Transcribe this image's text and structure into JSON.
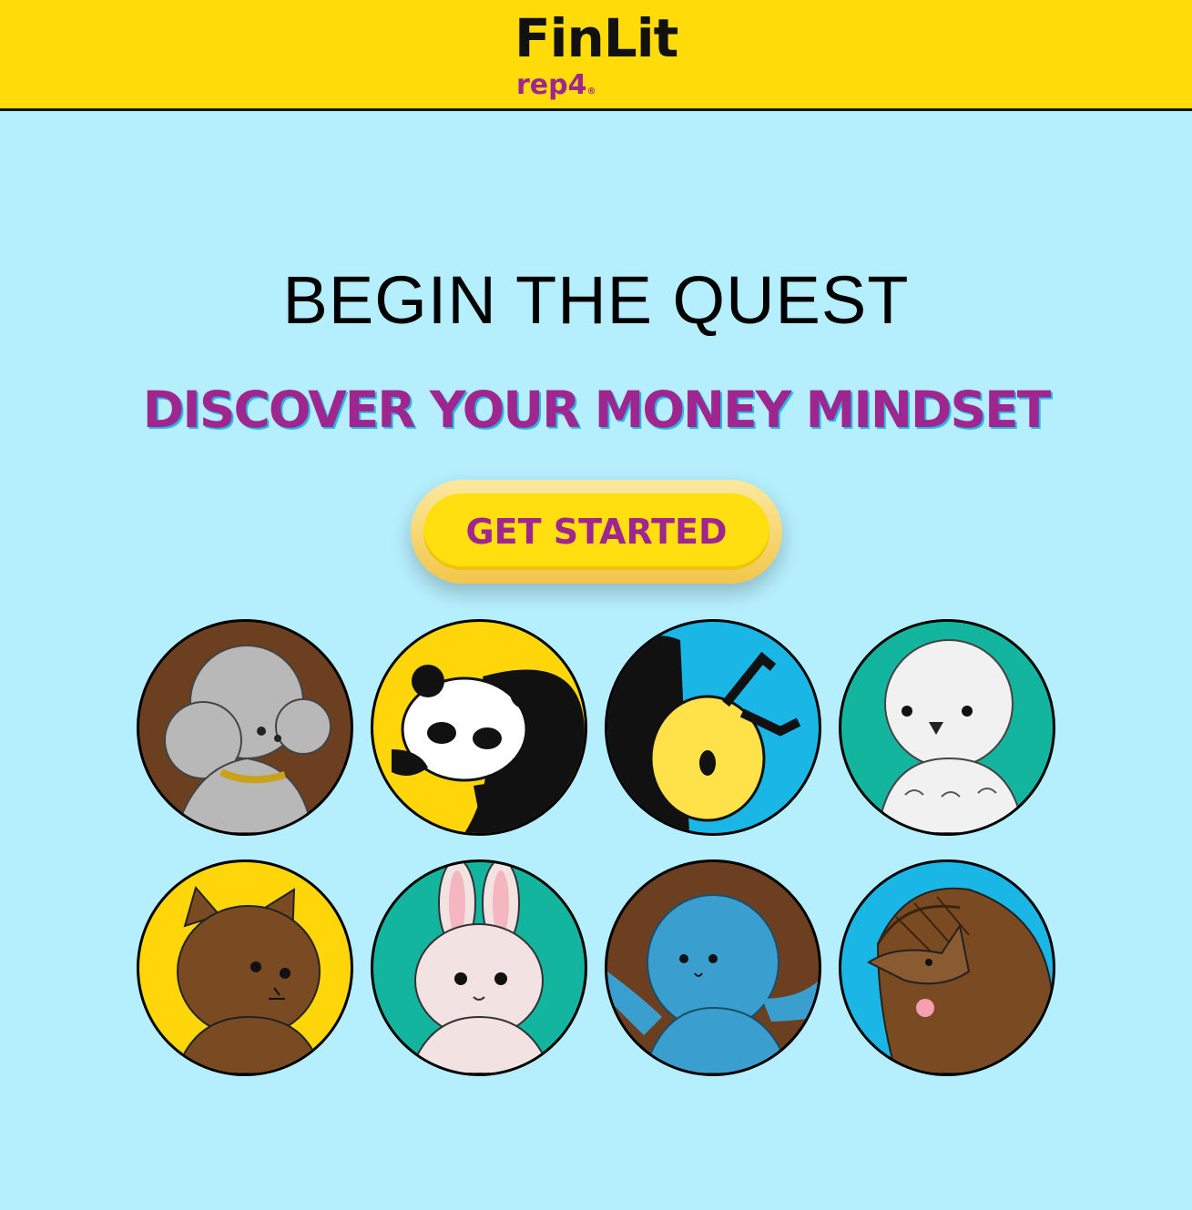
{
  "header": {
    "brand": "FinLit",
    "sub_brand": "rep4",
    "sub_brand_mark": "®",
    "background": "#ffdb0a"
  },
  "hero": {
    "title": "BEGIN THE QUEST",
    "subtitle": "DISCOVER YOUR MONEY MINDSET",
    "cta_label": "GET STARTED",
    "accent": "#a0268f"
  },
  "avatars": [
    {
      "name": "poodle",
      "bg": "#6b3f1f"
    },
    {
      "name": "panda",
      "bg": "#ffd60a"
    },
    {
      "name": "bee",
      "bg": "#1ab7e6"
    },
    {
      "name": "owl",
      "bg": "#14b59e"
    },
    {
      "name": "hamster",
      "bg": "#ffd60a"
    },
    {
      "name": "bunny",
      "bg": "#14b59e"
    },
    {
      "name": "octopus",
      "bg": "#6b3f1f"
    },
    {
      "name": "armadillo",
      "bg": "#1ab7e6"
    }
  ]
}
